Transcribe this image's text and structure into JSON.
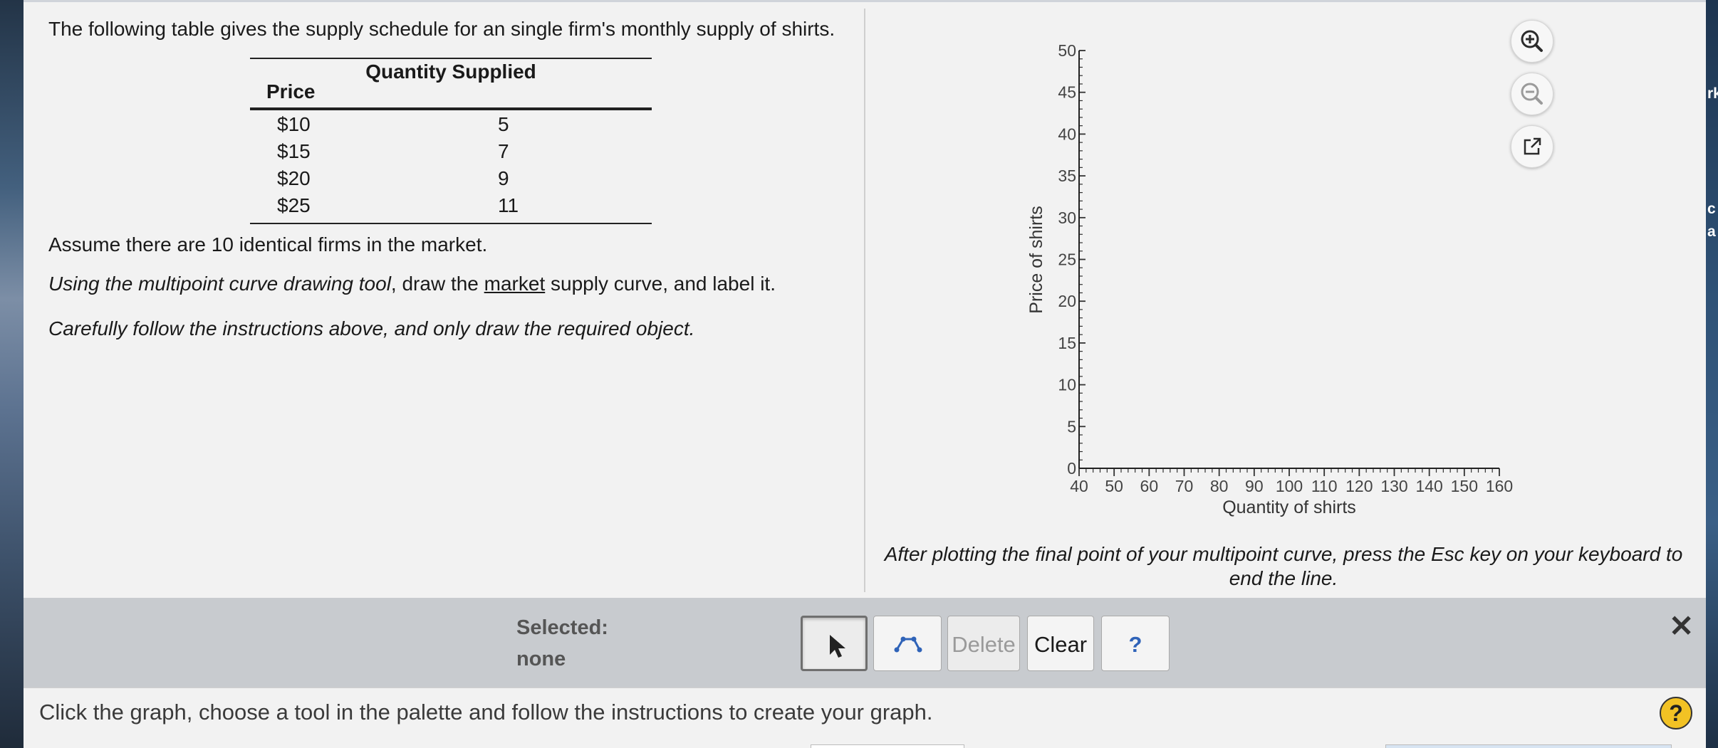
{
  "question": {
    "intro": "The following table gives the supply schedule for an single firm's monthly supply of shirts.",
    "table": {
      "headers": {
        "price": "Price",
        "quantity": "Quantity Supplied"
      },
      "rows": [
        {
          "price": "$10",
          "quantity": "5"
        },
        {
          "price": "$15",
          "quantity": "7"
        },
        {
          "price": "$20",
          "quantity": "9"
        },
        {
          "price": "$25",
          "quantity": "11"
        }
      ]
    },
    "assumption": "Assume there are 10 identical firms in the market.",
    "instruction": {
      "tool_phrase": "Using the multipoint curve drawing tool",
      "middle": ", draw the ",
      "underlined": "market",
      "end": " supply curve, and label it."
    },
    "caution": "Carefully follow the instructions above, and only draw the required object."
  },
  "graph": {
    "chart_data": {
      "type": "scatter",
      "series": [],
      "xlabel": "Quantity of shirts",
      "ylabel": "Price of shirts",
      "xlim": [
        40,
        160
      ],
      "ylim": [
        0,
        50
      ],
      "xticks": [
        40,
        50,
        60,
        70,
        80,
        90,
        100,
        110,
        120,
        130,
        140,
        150,
        160
      ],
      "yticks": [
        0,
        5,
        10,
        15,
        20,
        25,
        30,
        35,
        40,
        45,
        50
      ],
      "x_minor_step": 2,
      "y_minor_step": 1,
      "grid": false
    },
    "zoom_in_icon": "zoom-in-icon",
    "zoom_out_icon": "zoom-out-icon",
    "popout_icon": "external-link-icon",
    "esc_note": "After plotting the final point of your multipoint curve, press the Esc key on your keyboard to end the line."
  },
  "toolbar": {
    "selected_label": "Selected:",
    "selected_value": "none",
    "pointer_icon": "pointer-arrow-icon",
    "curve_icon": "multipoint-curve-icon",
    "delete_label": "Delete",
    "clear_label": "Clear",
    "help_label": "?",
    "close_icon": "close-icon",
    "close_glyph": "✕",
    "colors": {
      "accent": "#2f63b8",
      "disabled_text": "#9a9a9a",
      "panel": "#c8cbcf"
    }
  },
  "status": {
    "text": "Click the graph, choose a tool in the palette and follow the instructions to create your graph.",
    "help_glyph": "?"
  },
  "desktop_edge": {
    "right_fragments": [
      "rk",
      "c",
      "a"
    ]
  }
}
